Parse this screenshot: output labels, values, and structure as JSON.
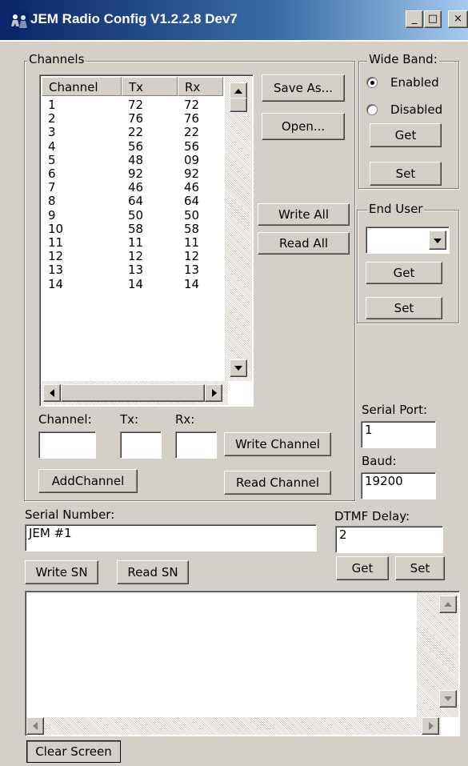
{
  "window": {
    "title": "JEM Radio Config V1.2.2.8 Dev7",
    "minimize": "_",
    "maximize": "□",
    "close": "×"
  },
  "channels": {
    "group_label": "Channels",
    "columns": [
      "Channel",
      "Tx",
      "Rx"
    ],
    "rows": [
      [
        "1",
        "72",
        "72"
      ],
      [
        "2",
        "76",
        "76"
      ],
      [
        "3",
        "22",
        "22"
      ],
      [
        "4",
        "56",
        "56"
      ],
      [
        "5",
        "48",
        "09"
      ],
      [
        "6",
        "92",
        "92"
      ],
      [
        "7",
        "46",
        "46"
      ],
      [
        "8",
        "64",
        "64"
      ],
      [
        "9",
        "50",
        "50"
      ],
      [
        "10",
        "58",
        "58"
      ],
      [
        "11",
        "11",
        "11"
      ],
      [
        "12",
        "12",
        "12"
      ],
      [
        "13",
        "13",
        "13"
      ],
      [
        "14",
        "14",
        "14"
      ]
    ],
    "save_as": "Save As...",
    "open": "Open...",
    "write_all": "Write All",
    "read_all": "Read All",
    "channel_label": "Channel:",
    "tx_label": "Tx:",
    "rx_label": "Rx:",
    "channel_value": "",
    "tx_value": "",
    "rx_value": "",
    "write_channel": "Write Channel",
    "add_channel": "AddChannel",
    "read_channel": "Read Channel"
  },
  "wide_band": {
    "group_label": "Wide Band:",
    "enabled": "Enabled",
    "disabled": "Disabled",
    "selected": "Enabled",
    "get": "Get",
    "set": "Set"
  },
  "end_user": {
    "group_label": "End User",
    "value": "",
    "get": "Get",
    "set": "Set"
  },
  "serial_port": {
    "label": "Serial Port:",
    "value": "1"
  },
  "baud": {
    "label": "Baud:",
    "value": "19200"
  },
  "serial_number": {
    "label": "Serial Number:",
    "value": "JEM #1",
    "write": "Write SN",
    "read": "Read SN"
  },
  "dtmf": {
    "label": "DTMF Delay:",
    "value": "2",
    "get": "Get",
    "set": "Set"
  },
  "output": {
    "text": "",
    "clear": "Clear Screen"
  }
}
